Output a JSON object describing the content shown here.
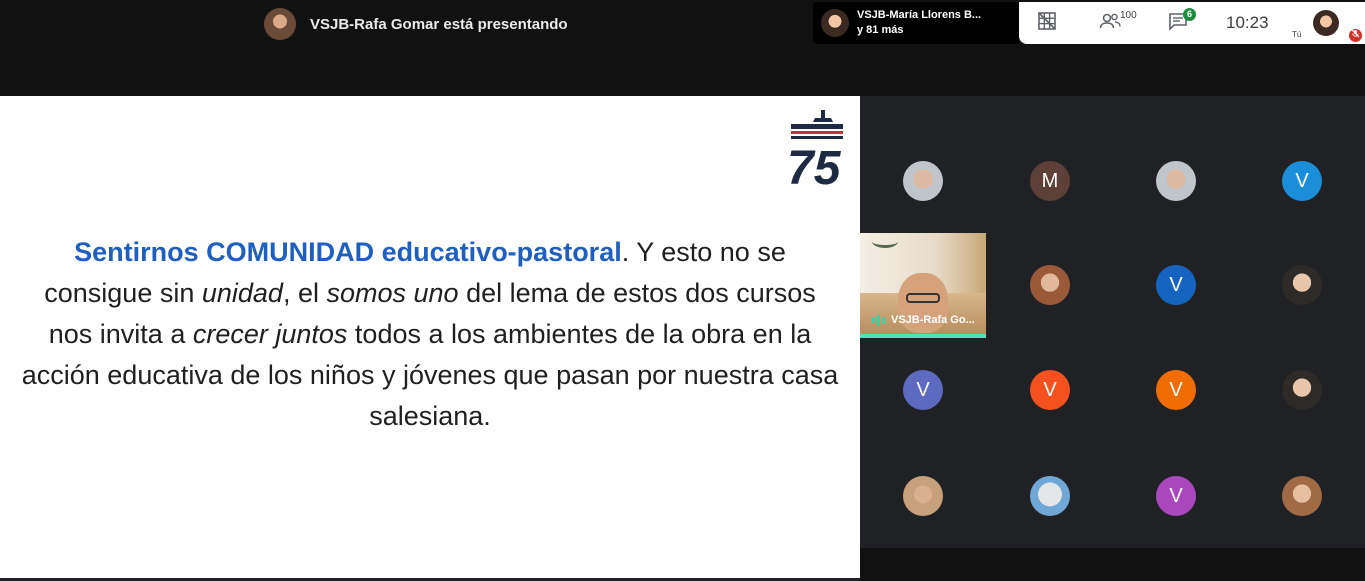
{
  "presenter": {
    "label": "VSJB-Rafa Gomar está presentando"
  },
  "pip": {
    "name": "VSJB-María Llorens B...",
    "others": "y 81 más"
  },
  "controls": {
    "people_count": "100",
    "chat_badge": "6",
    "clock": "10:23",
    "self_label": "Tú"
  },
  "slide": {
    "logo_number": "75",
    "text_highlight": "Sentirnos COMUNIDAD educativo-pastoral",
    "text_1": ". Y esto no se consigue sin ",
    "text_unidad": "unidad",
    "text_2": ", el ",
    "text_somos_uno": "somos uno",
    "text_3": " del lema de estos dos cursos nos invita a ",
    "text_crecer": "crecer juntos",
    "text_4": " todos a los ambientes de la obra en la acción educativa de los niños y jóvenes que pasan por nuestra casa salesiana."
  },
  "video_tile": {
    "label": "VSJB-Rafa Go..."
  },
  "participants": [
    {
      "initial": "",
      "color": "#9aa0a6"
    },
    {
      "initial": "M",
      "color": "#5d4037"
    },
    {
      "initial": "",
      "color": "#9aa0a6"
    },
    {
      "initial": "V",
      "color": "#1a8ed8"
    },
    {
      "initial": "",
      "color": "#9aa0a6"
    },
    {
      "initial": "V",
      "color": "#1565c0"
    },
    {
      "initial": "",
      "color": "#9aa0a6"
    },
    {
      "initial": "V",
      "color": "#5c6bc0"
    },
    {
      "initial": "V",
      "color": "#f4511e"
    },
    {
      "initial": "V",
      "color": "#ef6c00"
    },
    {
      "initial": "",
      "color": "#9aa0a6"
    },
    {
      "initial": "",
      "color": "#9aa0a6"
    },
    {
      "initial": "",
      "color": "#9aa0a6"
    },
    {
      "initial": "V",
      "color": "#ab47bc"
    },
    {
      "initial": "",
      "color": "#9aa0a6"
    }
  ],
  "icons": [
    "layout-grid-icon",
    "people-icon",
    "chat-icon",
    "mic-off-icon"
  ]
}
